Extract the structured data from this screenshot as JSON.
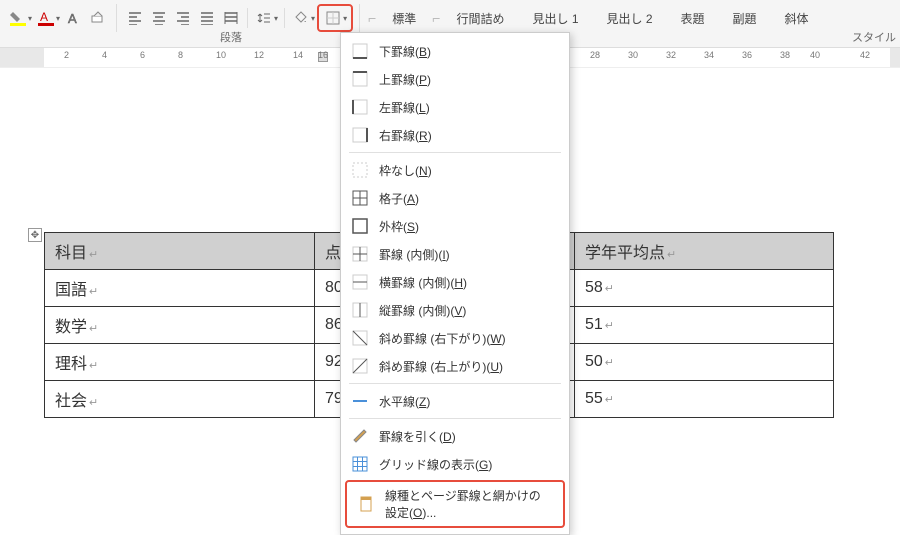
{
  "toolbar": {
    "paragraph_label": "段落",
    "style_label": "スタイル"
  },
  "styles": {
    "standard": "標準",
    "no_spacing": "行間詰め",
    "heading1": "見出し 1",
    "heading2": "見出し 2",
    "title": "表題",
    "subtitle": "副題",
    "italic": "斜体"
  },
  "ruler": {
    "ticks": [
      "2",
      "4",
      "6",
      "8",
      "10",
      "12",
      "14",
      "16",
      "28",
      "30",
      "32",
      "34",
      "36",
      "38",
      "40",
      "42"
    ]
  },
  "table": {
    "headers": [
      "科目",
      "点",
      "学年平均点"
    ],
    "rows": [
      {
        "subject": "国語",
        "score": "80",
        "avg": "58"
      },
      {
        "subject": "数学",
        "score": "86",
        "avg": "51"
      },
      {
        "subject": "理科",
        "score": "92",
        "avg": "50"
      },
      {
        "subject": "社会",
        "score": "79",
        "avg": "55"
      }
    ]
  },
  "menu": {
    "bottom_border": "下罫線",
    "bottom_border_key": "B",
    "top_border": "上罫線",
    "top_border_key": "P",
    "left_border": "左罫線",
    "left_border_key": "L",
    "right_border": "右罫線",
    "right_border_key": "R",
    "no_border": "枠なし",
    "no_border_key": "N",
    "all_borders": "格子",
    "all_borders_key": "A",
    "outside": "外枠",
    "outside_key": "S",
    "inside": "罫線 (内側)",
    "inside_key": "I",
    "inside_h": "横罫線 (内側)",
    "inside_h_key": "H",
    "inside_v": "縦罫線 (内側)",
    "inside_v_key": "V",
    "diag_down": "斜め罫線 (右下がり)",
    "diag_down_key": "W",
    "diag_up": "斜め罫線 (右上がり)",
    "diag_up_key": "U",
    "hr": "水平線",
    "hr_key": "Z",
    "draw": "罫線を引く",
    "draw_key": "D",
    "grid": "グリッド線の表示",
    "grid_key": "G",
    "settings": "線種とページ罫線と網かけの設定",
    "settings_key": "O",
    "settings_suffix": "..."
  }
}
